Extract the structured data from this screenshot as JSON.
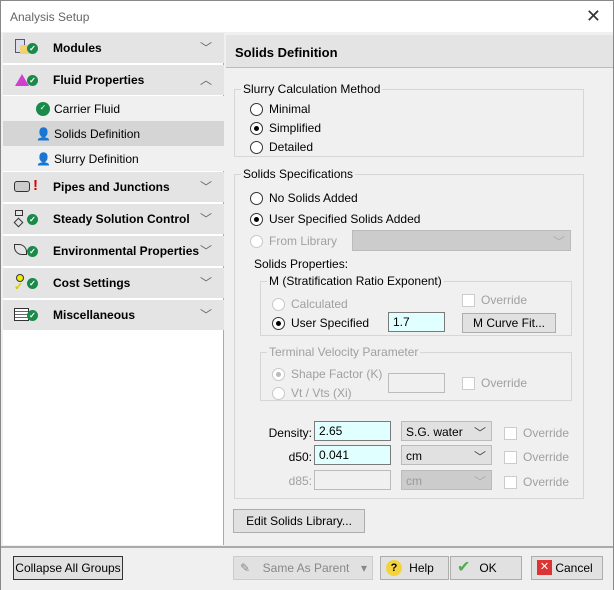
{
  "window": {
    "title": "Analysis Setup",
    "close_icon": "close-icon"
  },
  "sidebar": {
    "groups": [
      {
        "label": "Modules",
        "icon": "modules-icon",
        "status": "ok",
        "expanded": false
      },
      {
        "label": "Fluid Properties",
        "icon": "flask-icon",
        "status": "ok",
        "expanded": true,
        "items": [
          {
            "label": "Carrier Fluid",
            "status": "ok"
          },
          {
            "label": "Solids Definition",
            "status": "user-defined",
            "selected": true
          },
          {
            "label": "Slurry Definition",
            "status": "user-defined"
          }
        ]
      },
      {
        "label": "Pipes and Junctions",
        "icon": "pipe-icon",
        "status": "error",
        "expanded": false
      },
      {
        "label": "Steady Solution Control",
        "icon": "flowchart-icon",
        "status": "ok",
        "expanded": false
      },
      {
        "label": "Environmental Properties",
        "icon": "leaf-icon",
        "status": "ok",
        "expanded": false
      },
      {
        "label": "Cost Settings",
        "icon": "cost-icon",
        "status": "ok",
        "expanded": false
      },
      {
        "label": "Miscellaneous",
        "icon": "list-icon",
        "status": "ok",
        "expanded": false
      }
    ]
  },
  "main": {
    "header": "Solids Definition",
    "slurry_method": {
      "legend": "Slurry Calculation Method",
      "options": [
        "Minimal",
        "Simplified",
        "Detailed"
      ],
      "selected": "Simplified"
    },
    "solids_spec": {
      "legend": "Solids Specifications",
      "options": [
        "No Solids Added",
        "User Specified Solids Added",
        "From Library"
      ],
      "selected": "User Specified Solids Added",
      "library_value": ""
    },
    "solids_properties_label": "Solids Properties:",
    "m_group": {
      "legend": "M (Stratification Ratio Exponent)",
      "options": [
        "Calculated",
        "User Specified"
      ],
      "selected": "User Specified",
      "value": "1.7",
      "override": "Override",
      "curve_fit": "M Curve Fit..."
    },
    "tvp_group": {
      "legend": "Terminal Velocity Parameter",
      "options": [
        "Shape Factor (K)",
        "Vt / Vts (Xi)"
      ],
      "selected": "Shape Factor (K)",
      "value": "",
      "override": "Override"
    },
    "density": {
      "label": "Density:",
      "value": "2.65",
      "unit": "S.G. water",
      "override": "Override"
    },
    "d50": {
      "label": "d50:",
      "value": "0.041",
      "unit": "cm",
      "override": "Override"
    },
    "d85": {
      "label": "d85:",
      "value": "",
      "unit": "cm",
      "override": "Override"
    },
    "edit_library": "Edit Solids Library..."
  },
  "footer": {
    "collapse": "Collapse All Groups",
    "same_as_parent": "Same As Parent",
    "help": "Help",
    "ok": "OK",
    "cancel": "Cancel"
  }
}
